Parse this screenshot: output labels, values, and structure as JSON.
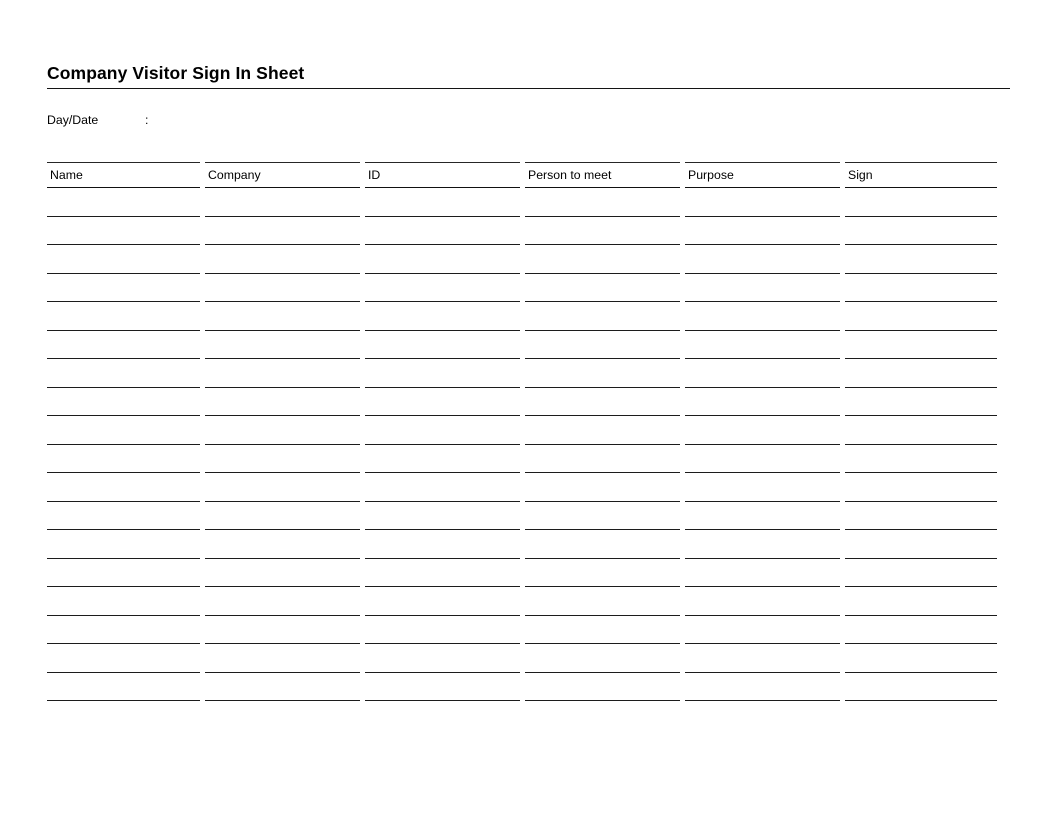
{
  "document": {
    "title": "Company Visitor Sign In Sheet"
  },
  "meta": {
    "daydate_label": "Day/Date",
    "daydate_separator": ":",
    "daydate_value": ""
  },
  "table": {
    "columns": [
      {
        "key": "name",
        "label": "Name"
      },
      {
        "key": "company",
        "label": "Company"
      },
      {
        "key": "id",
        "label": "ID"
      },
      {
        "key": "person_to_meet",
        "label": "Person to meet"
      },
      {
        "key": "purpose",
        "label": "Purpose"
      },
      {
        "key": "sign",
        "label": "Sign"
      }
    ],
    "row_count": 18,
    "rows": [
      {
        "name": "",
        "company": "",
        "id": "",
        "person_to_meet": "",
        "purpose": "",
        "sign": ""
      },
      {
        "name": "",
        "company": "",
        "id": "",
        "person_to_meet": "",
        "purpose": "",
        "sign": ""
      },
      {
        "name": "",
        "company": "",
        "id": "",
        "person_to_meet": "",
        "purpose": "",
        "sign": ""
      },
      {
        "name": "",
        "company": "",
        "id": "",
        "person_to_meet": "",
        "purpose": "",
        "sign": ""
      },
      {
        "name": "",
        "company": "",
        "id": "",
        "person_to_meet": "",
        "purpose": "",
        "sign": ""
      },
      {
        "name": "",
        "company": "",
        "id": "",
        "person_to_meet": "",
        "purpose": "",
        "sign": ""
      },
      {
        "name": "",
        "company": "",
        "id": "",
        "person_to_meet": "",
        "purpose": "",
        "sign": ""
      },
      {
        "name": "",
        "company": "",
        "id": "",
        "person_to_meet": "",
        "purpose": "",
        "sign": ""
      },
      {
        "name": "",
        "company": "",
        "id": "",
        "person_to_meet": "",
        "purpose": "",
        "sign": ""
      },
      {
        "name": "",
        "company": "",
        "id": "",
        "person_to_meet": "",
        "purpose": "",
        "sign": ""
      },
      {
        "name": "",
        "company": "",
        "id": "",
        "person_to_meet": "",
        "purpose": "",
        "sign": ""
      },
      {
        "name": "",
        "company": "",
        "id": "",
        "person_to_meet": "",
        "purpose": "",
        "sign": ""
      },
      {
        "name": "",
        "company": "",
        "id": "",
        "person_to_meet": "",
        "purpose": "",
        "sign": ""
      },
      {
        "name": "",
        "company": "",
        "id": "",
        "person_to_meet": "",
        "purpose": "",
        "sign": ""
      },
      {
        "name": "",
        "company": "",
        "id": "",
        "person_to_meet": "",
        "purpose": "",
        "sign": ""
      },
      {
        "name": "",
        "company": "",
        "id": "",
        "person_to_meet": "",
        "purpose": "",
        "sign": ""
      },
      {
        "name": "",
        "company": "",
        "id": "",
        "person_to_meet": "",
        "purpose": "",
        "sign": ""
      },
      {
        "name": "",
        "company": "",
        "id": "",
        "person_to_meet": "",
        "purpose": "",
        "sign": ""
      }
    ]
  },
  "colors": {
    "page_background": "#ffffff",
    "text": "#000000",
    "rule": "#1c1c1c"
  }
}
